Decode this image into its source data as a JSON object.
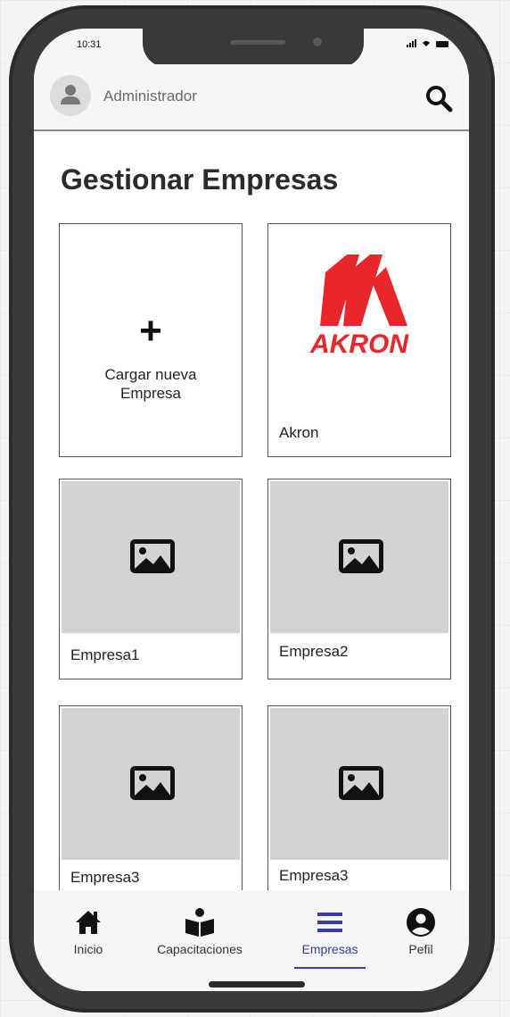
{
  "status_bar": {
    "time": "10:31"
  },
  "header": {
    "user_name": "Administrador"
  },
  "page": {
    "title": "Gestionar Empresas"
  },
  "add_card": {
    "line1": "Cargar nueva",
    "line2": "Empresa"
  },
  "companies": [
    {
      "name": "Akron",
      "logo_text": "AKRON"
    },
    {
      "name": "Empresa1"
    },
    {
      "name": "Empresa2"
    },
    {
      "name": "Empresa3"
    },
    {
      "name": "Empresa3"
    }
  ],
  "bottom_nav": [
    {
      "label": "Inicio",
      "icon": "home-icon"
    },
    {
      "label": "Capacitaciones",
      "icon": "book-reader-icon"
    },
    {
      "label": "Empresas",
      "icon": "menu-icon",
      "active": true
    },
    {
      "label": "Pefil",
      "icon": "user-circle-icon"
    }
  ],
  "colors": {
    "active": "#3a3ab4",
    "brand_red": "#e8262b"
  }
}
